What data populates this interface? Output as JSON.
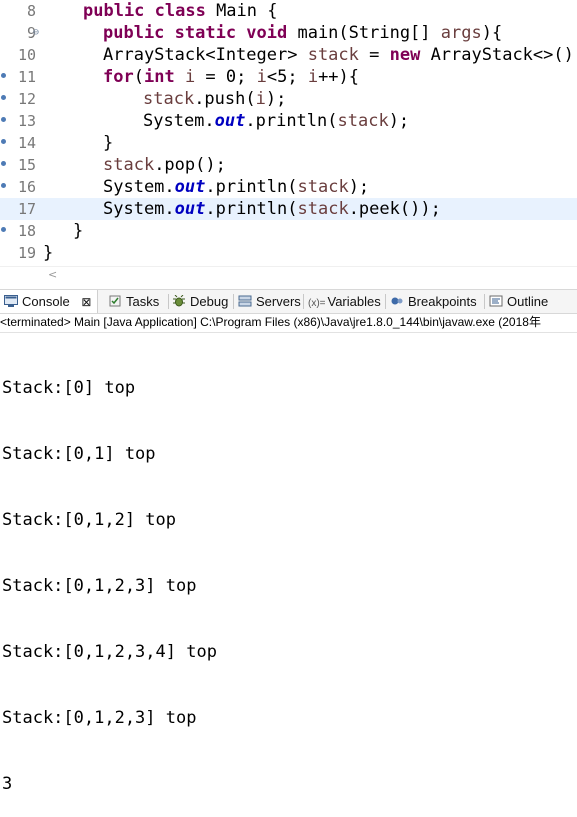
{
  "editor": {
    "lines": [
      {
        "n": "8"
      },
      {
        "n": "9",
        "fold": "⊖"
      },
      {
        "n": "10"
      },
      {
        "n": "11",
        "marker": true
      },
      {
        "n": "12",
        "marker": true
      },
      {
        "n": "13",
        "marker": true
      },
      {
        "n": "14",
        "marker": true
      },
      {
        "n": "15",
        "marker": true
      },
      {
        "n": "16",
        "marker": true
      },
      {
        "n": "17"
      },
      {
        "n": "18",
        "marker": true
      },
      {
        "n": "19"
      }
    ],
    "code": {
      "l8_kw": "public class",
      "l8_rest": " Main {",
      "l9_kw": "public static void",
      "l9_a": " main(String[] ",
      "l9_var": "args",
      "l9_b": "){",
      "l10_a": "ArrayStack<Integer> ",
      "l10_var": "stack",
      "l10_b": " = ",
      "l10_kw": "new",
      "l10_c": " ArrayStack<>();",
      "l11_kw": "for",
      "l11_a": "(",
      "l11_kw2": "int",
      "l11_b": " ",
      "l11_var": "i",
      "l11_c": " = 0; ",
      "l11_var2": "i",
      "l11_d": "<5; ",
      "l11_var3": "i",
      "l11_e": "++){",
      "l12_var": "stack",
      "l12_a": ".push(",
      "l12_var2": "i",
      "l12_b": ");",
      "l13_a": "System.",
      "l13_fld": "out",
      "l13_b": ".println(",
      "l13_var": "stack",
      "l13_c": ");",
      "l14": "}",
      "l15_var": "stack",
      "l15_a": ".pop();",
      "l16_a": "System.",
      "l16_fld": "out",
      "l16_b": ".println(",
      "l16_var": "stack",
      "l16_c": ");",
      "l17_a": "System.",
      "l17_fld": "out",
      "l17_b": ".println(",
      "l17_var": "stack",
      "l17_c": ".peek());",
      "l18": "}",
      "l19": "}"
    },
    "scroll_left_arrow": "<"
  },
  "tabs": {
    "console": "Console",
    "console_close": "⊠",
    "tasks": "Tasks",
    "debug": "Debug",
    "servers": "Servers",
    "variables_prefix": "(x)=",
    "variables": "Variables",
    "breakpoints": "Breakpoints",
    "outline": "Outline"
  },
  "status": "<terminated> Main [Java Application] C:\\Program Files (x86)\\Java\\jre1.8.0_144\\bin\\javaw.exe (2018年",
  "console_output": [
    "Stack:[0] top",
    "Stack:[0,1] top",
    "Stack:[0,1,2] top",
    "Stack:[0,1,2,3] top",
    "Stack:[0,1,2,3,4] top",
    "Stack:[0,1,2,3] top",
    "3"
  ],
  "colors": {
    "keyword": "#7f0055",
    "field": "#0000c0",
    "variable": "#6a3e3e",
    "current_line": "#e8f2fe"
  }
}
